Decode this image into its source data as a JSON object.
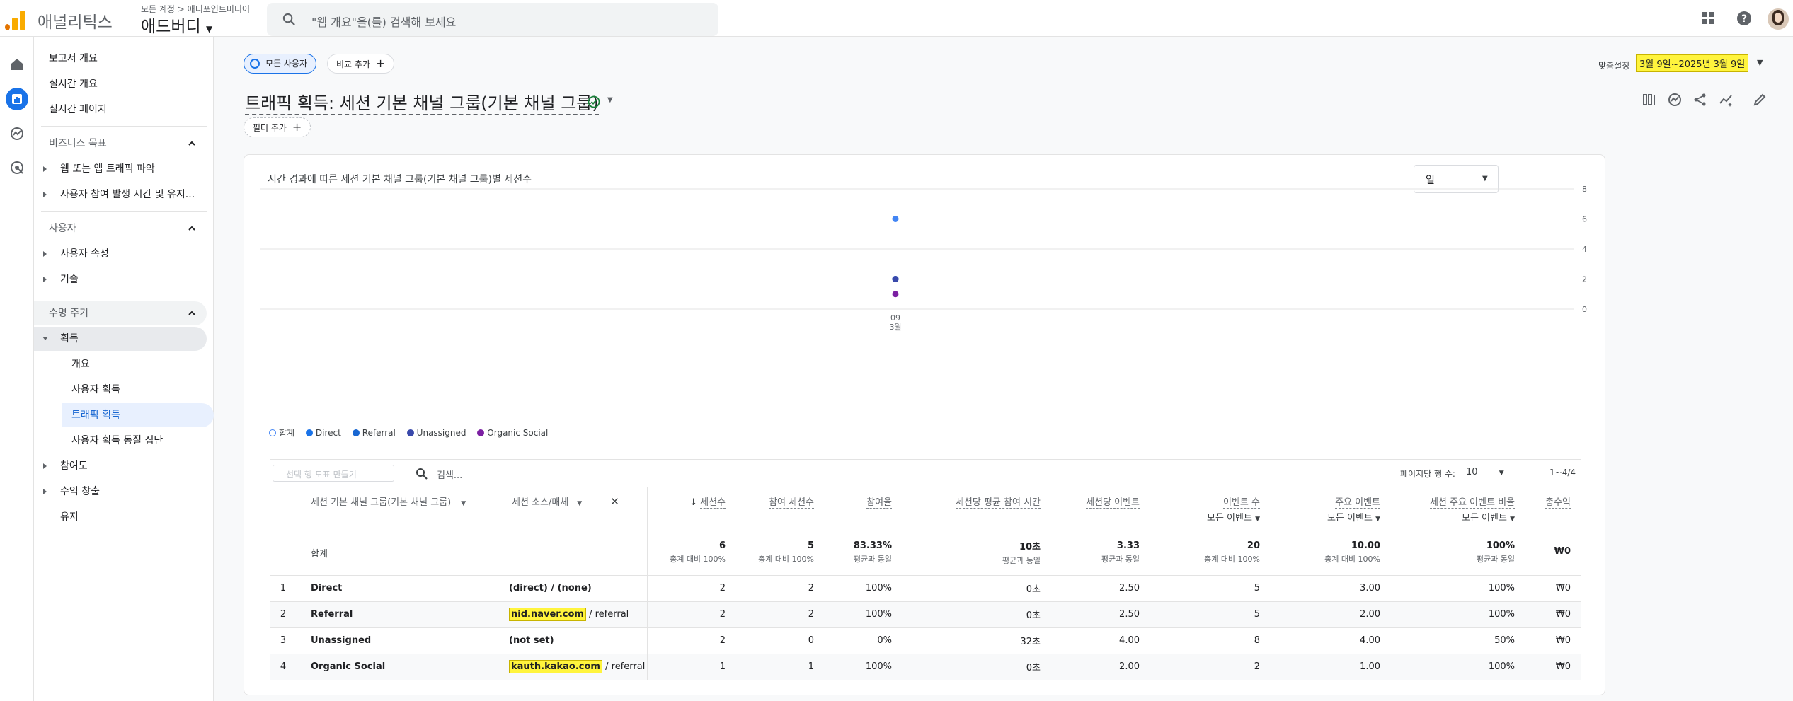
{
  "header": {
    "app_name": "애널리틱스",
    "account_crumb": "모든 계정 > 애니포인트미디어",
    "property_name": "애드버디",
    "search_placeholder": "\"웹 개요\"을(를) 검색해 보세요"
  },
  "nav": {
    "items": [
      {
        "label": "보고서 개요"
      },
      {
        "label": "실시간 개요"
      },
      {
        "label": "실시간 페이지"
      }
    ],
    "sections": [
      {
        "label": "비즈니스 목표"
      },
      {
        "label": "사용자"
      },
      {
        "label": "수명 주기"
      }
    ],
    "business": [
      "웹 또는 앱 트래픽 파악",
      "사용자 참여 발생 시간 및 유지..."
    ],
    "user": [
      "사용자 속성",
      "기술"
    ],
    "lifecycle_parent": "획득",
    "lifecycle_children": [
      "개요",
      "사용자 획득",
      "트래픽 획득",
      "사용자 획득 동질 집단"
    ],
    "lifecycle_rest": [
      "참여도",
      "수익 창출"
    ],
    "retention": "유지"
  },
  "toolbar": {
    "all_users_chip": "모든 사용자",
    "compare_chip": "비교 추가",
    "custom_label": "맞춤설정",
    "date_range": "3월 9일~2025년 3월 9일",
    "add_filter": "필터 추가"
  },
  "page": {
    "title": "트래픽 획득: 세션 기본 채널 그룹(기본 채널 그룹)"
  },
  "chart": {
    "title": "시간 경과에 따른 세션 기본 채널 그룹(기본 채널 그룹)별 세션수",
    "granularity": "일"
  },
  "chart_data": {
    "type": "scatter",
    "title": "시간 경과에 따른 세션 기본 채널 그룹(기본 채널 그룹)별 세션수",
    "x": [
      "09 3월"
    ],
    "x_tick_day": "09",
    "x_tick_month": "3월",
    "ylim": [
      0,
      8
    ],
    "y_ticks": [
      "8",
      "6",
      "4",
      "2",
      "0"
    ],
    "grid": true,
    "legend_placement": "bottom-left",
    "series": [
      {
        "name": "합계",
        "values": [
          6
        ],
        "color": "#4285f4"
      },
      {
        "name": "Direct",
        "values": [
          2
        ],
        "color": "#1a73e8"
      },
      {
        "name": "Referral",
        "values": [
          2
        ],
        "color": "#1967d2"
      },
      {
        "name": "Unassigned",
        "values": [
          2
        ],
        "color": "#3949ab"
      },
      {
        "name": "Organic Social",
        "values": [
          1
        ],
        "color": "#7b1fa2"
      }
    ]
  },
  "table": {
    "create_chart_placeholder": "선택 행 도표 만들기",
    "search_placeholder": "검색...",
    "rows_per_page_label": "페이지당 행 수:",
    "rows_per_page": "10",
    "pagination": "1~4/4",
    "dim1_header": "세션 기본 채널 그룹(기본 채널 그룹)",
    "dim2_header": "세션 소스/매체",
    "columns": [
      {
        "label": "세션수",
        "sub": ""
      },
      {
        "label": "참여 세션수",
        "sub": ""
      },
      {
        "label": "참여율",
        "sub": ""
      },
      {
        "label": "세션당 평균 참여 시간",
        "sub": ""
      },
      {
        "label": "세션당 이벤트",
        "sub": ""
      },
      {
        "label": "이벤트 수",
        "sub": "모든 이벤트"
      },
      {
        "label": "주요 이벤트",
        "sub": "모든 이벤트"
      },
      {
        "label": "세션 주요 이벤트 비율",
        "sub": "모든 이벤트"
      },
      {
        "label": "총수익",
        "sub": ""
      }
    ],
    "totals": {
      "label": "합계",
      "values": [
        "6",
        "5",
        "83.33%",
        "10초",
        "3.33",
        "20",
        "10.00",
        "100%",
        "₩0"
      ],
      "subs": [
        "총계 대비 100%",
        "총계 대비 100%",
        "평균과 동일",
        "평균과 동일",
        "평균과 동일",
        "총계 대비 100%",
        "총계 대비 100%",
        "평균과 동일",
        ""
      ]
    },
    "rows": [
      {
        "rank": "1",
        "channel": "Direct",
        "source": "",
        "source_rest": "(direct) / (none)",
        "values": [
          "2",
          "2",
          "100%",
          "0초",
          "2.50",
          "5",
          "3.00",
          "100%",
          "₩0"
        ]
      },
      {
        "rank": "2",
        "channel": "Referral",
        "source": "nid.naver.com",
        "source_rest": " / referral",
        "values": [
          "2",
          "2",
          "100%",
          "0초",
          "2.50",
          "5",
          "2.00",
          "100%",
          "₩0"
        ]
      },
      {
        "rank": "3",
        "channel": "Unassigned",
        "source": "",
        "source_rest": "(not set)",
        "values": [
          "2",
          "0",
          "0%",
          "32초",
          "4.00",
          "8",
          "4.00",
          "50%",
          "₩0"
        ]
      },
      {
        "rank": "4",
        "channel": "Organic Social",
        "source": "kauth.kakao.com",
        "source_rest": " / referral",
        "values": [
          "1",
          "1",
          "100%",
          "0초",
          "2.00",
          "2",
          "1.00",
          "100%",
          "₩0"
        ]
      }
    ]
  }
}
